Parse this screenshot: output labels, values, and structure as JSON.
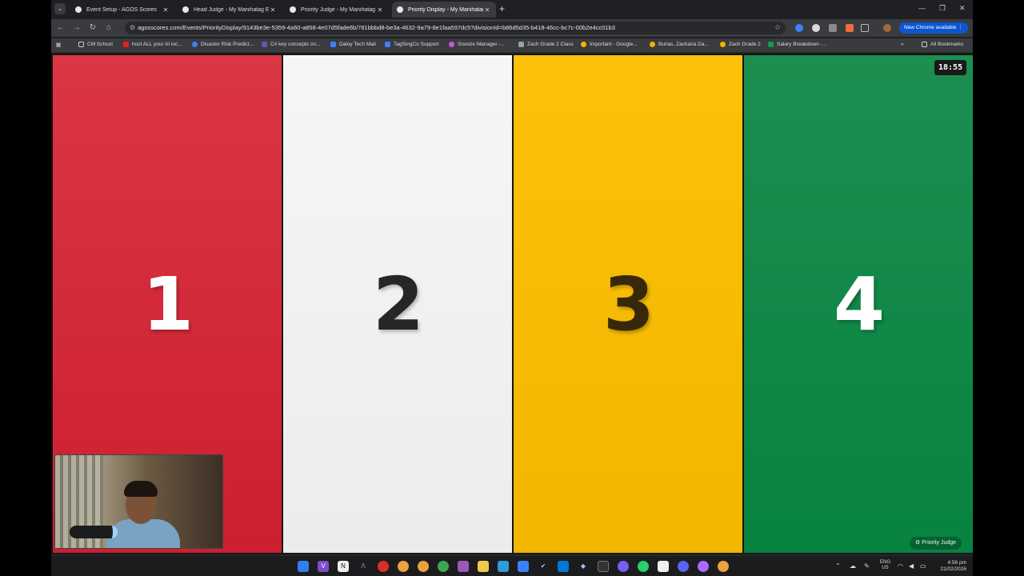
{
  "browser": {
    "tabs": [
      {
        "label": "Event Setup - AGOS Scores",
        "active": false
      },
      {
        "label": "Head Judge - My Manihatag Ev",
        "active": false
      },
      {
        "label": "Priority Judge - My Manihatag",
        "active": false
      },
      {
        "label": "Priority Display - My Manihatag",
        "active": true
      }
    ],
    "url": "agosscores.com/Events/PriorityDisplay/9143be3e-5359-4a60-a858-4e07d5fade6b/781bbbd8-be3a-4632-9a79-8e1faa597dc5?divisionId=b86d5d35-b418-46cc-bc7c-00b2e4cc01b3",
    "new_chrome_label": "New Chrome available",
    "bookmarks": [
      "CM School",
      "host ALL your AI loc...",
      "Disaster Risk Predict...",
      "C# key concepts on...",
      "Daloy Tech Mail",
      "TagSingCo Support",
      "Snooze Manager -...",
      "Zach Grade 2 Class",
      "Important - Google...",
      "Burias, Zacharia Da...",
      "Zach Grade 2",
      "Salary Breakdown -..."
    ],
    "all_bookmarks_label": "All Bookmarks"
  },
  "display": {
    "panels": [
      {
        "number": "1",
        "color": "#cc1f2f"
      },
      {
        "number": "2",
        "color": "#f2f2f2"
      },
      {
        "number": "3",
        "color": "#f5b800"
      },
      {
        "number": "4",
        "color": "#078341"
      }
    ],
    "timer": "18:55",
    "priority_judge_label": "Priority Judge"
  },
  "taskbar": {
    "language": "ENG",
    "region": "US",
    "time": "4:56 pm",
    "date": "21/02/2026"
  }
}
